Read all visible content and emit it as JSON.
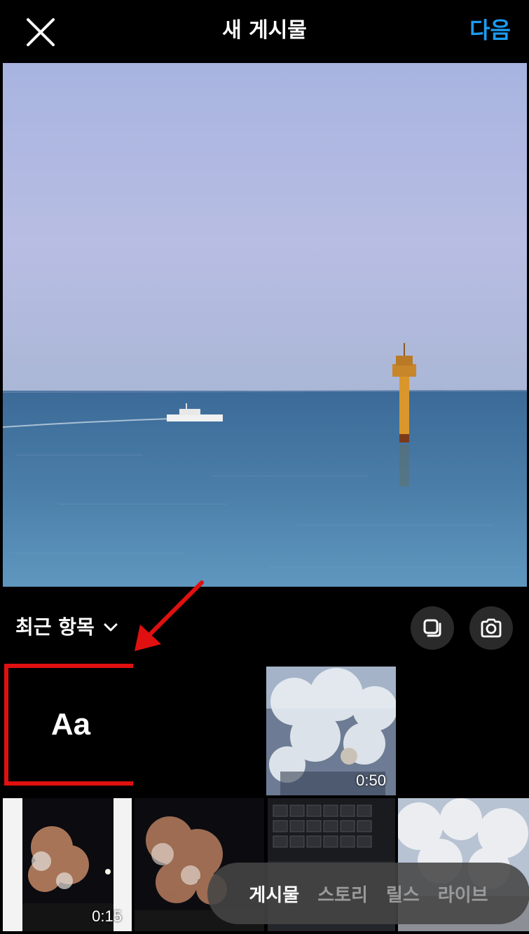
{
  "header": {
    "title": "새 게시물",
    "next_label": "다음",
    "next_color": "#1d9bf0"
  },
  "album": {
    "label": "최근 항목"
  },
  "grid": {
    "text_tile_label": "Aa",
    "durations": {
      "cherry_video": "0:50",
      "night_video": "0:15"
    }
  },
  "modes": [
    "게시물",
    "스토리",
    "릴스",
    "라이브"
  ],
  "colors": {
    "annotation": "#e01010",
    "pill_bg": "#464646"
  }
}
